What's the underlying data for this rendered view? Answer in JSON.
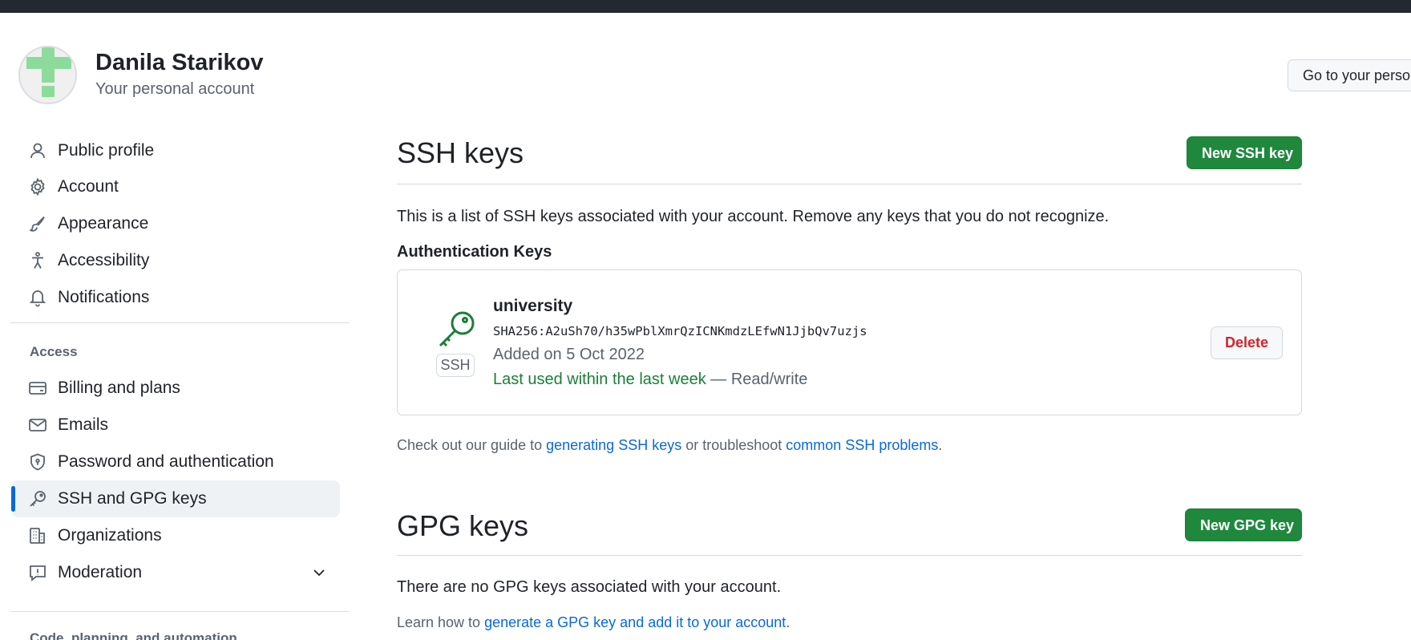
{
  "header": {
    "user_name": "Danila Starikov",
    "user_subtitle": "Your personal account",
    "goto_button": "Go to your personal profile"
  },
  "sidebar": {
    "items": [
      {
        "label": "Public profile",
        "icon": "person-icon"
      },
      {
        "label": "Account",
        "icon": "gear-icon"
      },
      {
        "label": "Appearance",
        "icon": "paintbrush-icon"
      },
      {
        "label": "Accessibility",
        "icon": "accessibility-icon"
      },
      {
        "label": "Notifications",
        "icon": "bell-icon"
      }
    ],
    "section_access": "Access",
    "access_items": [
      {
        "label": "Billing and plans",
        "icon": "credit-card-icon"
      },
      {
        "label": "Emails",
        "icon": "mail-icon"
      },
      {
        "label": "Password and authentication",
        "icon": "shield-lock-icon"
      },
      {
        "label": "SSH and GPG keys",
        "icon": "key-icon",
        "selected": true
      },
      {
        "label": "Organizations",
        "icon": "organization-icon"
      },
      {
        "label": "Moderation",
        "icon": "report-icon"
      }
    ],
    "section_code": "Code, planning, and automation"
  },
  "ssh": {
    "title": "SSH keys",
    "new_button": "New SSH key",
    "description": "This is a list of SSH keys associated with your account. Remove any keys that you do not recognize.",
    "auth_heading": "Authentication Keys",
    "keys": [
      {
        "title": "university",
        "badge": "SSH",
        "fingerprint": "SHA256:A2uSh70/h35wPblXmrQzICNKmdzLEfwN1JjbQv7uzjs",
        "added": "Added on 5 Oct 2022",
        "last_used": "Last used within the last week",
        "access": " — Read/write",
        "delete": "Delete"
      }
    ],
    "guide": {
      "prefix": "Check out our guide to ",
      "link1": "generating SSH keys",
      "middle": " or troubleshoot ",
      "link2": "common SSH problems",
      "suffix": "."
    }
  },
  "gpg": {
    "title": "GPG keys",
    "new_button": "New GPG key",
    "empty": "There are no GPG keys associated with your account.",
    "learn": {
      "prefix": "Learn how to ",
      "link": "generate a GPG key and add it to your account",
      "suffix": "."
    }
  },
  "colors": {
    "accent": "#0969da",
    "primary_button": "#1f883d",
    "danger": "#d1242f",
    "success_text": "#1a7f37",
    "topbar": "#24292f"
  }
}
